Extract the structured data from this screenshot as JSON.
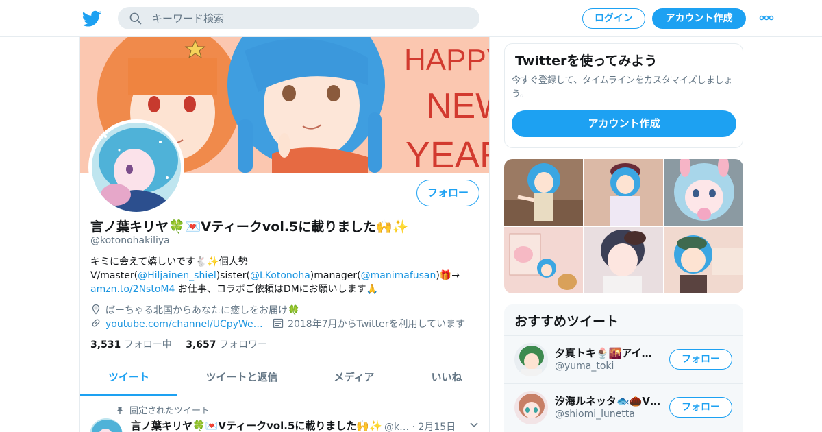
{
  "header": {
    "search_placeholder": "キーワード検索",
    "login_label": "ログイン",
    "signup_label": "アカウント作成"
  },
  "profile": {
    "follow_label": "フォロー",
    "name": "言ノ葉キリヤ🍀💌Vティークvol.5に載りました🙌✨",
    "handle": "@kotonohakiliya",
    "bio": {
      "line1": "キミに会えて嬉しいです🐇✨個人勢",
      "p1": "V/master(",
      "m1": "@Hiljainen_shiel",
      "p2": ")sister(",
      "m2": "@LKotonoha",
      "p3": ")manager(",
      "m3": "@manimafusan",
      "p4": ")🎁→",
      "link": "amzn.to/2NstoM4",
      "p5": " お仕事、コラボご依頼はDMにお願いします🙏"
    },
    "location": "ばーちゃる北国からあなたに癒しをお届け🍀",
    "website": "youtube.com/channel/UCpyWe…",
    "joined": "2018年7月からTwitterを利用しています",
    "following_count": "3,531",
    "following_label": "フォロー中",
    "followers_count": "3,657",
    "followers_label": "フォロワー",
    "banner_text": [
      "HAPPY",
      "NEW",
      "YEAR!"
    ]
  },
  "tabs": [
    {
      "label": "ツイート",
      "active": true
    },
    {
      "label": "ツイートと返信",
      "active": false
    },
    {
      "label": "メディア",
      "active": false
    },
    {
      "label": "いいね",
      "active": false
    }
  ],
  "pinned_tweet": {
    "pinned_label": "固定されたツイート",
    "author": "言ノ葉キリヤ🍀💌Vティークvol.5に載りました🙌✨",
    "handle_short": "@k…",
    "date": "2月15日"
  },
  "signup_card": {
    "title": "Twitterを使ってみよう",
    "description": "今すぐ登録して、タイムラインをカスタマイズしましょう。",
    "button": "アカウント作成"
  },
  "recommended": {
    "title": "おすすめツイート",
    "follow_label": "フォロー",
    "users": [
      {
        "name": "夕真トキ🍨🌇アイ…",
        "handle": "@yuma_toki"
      },
      {
        "name": "汐海ルネッタ🐟🌰V…",
        "handle": "@shiomi_lunetta"
      }
    ]
  },
  "colors": {
    "accent": "#1da1f2",
    "link": "#1b95e0",
    "muted": "#657786",
    "border": "#e6ecf0"
  }
}
